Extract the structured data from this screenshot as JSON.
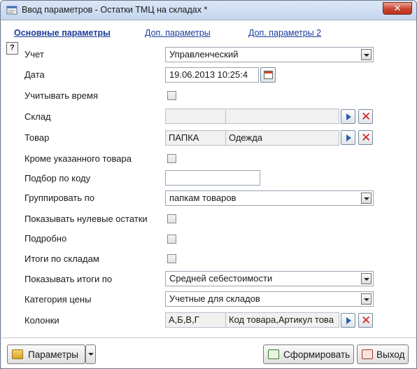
{
  "window": {
    "title": "Ввод параметров - Остатки ТМЦ на складах *",
    "close_label": "✕"
  },
  "tabs": [
    {
      "label": "Основные параметры",
      "active": true
    },
    {
      "label": "Доп. параметры",
      "active": false
    },
    {
      "label": "Доп. параметры 2",
      "active": false
    }
  ],
  "help_label": "?",
  "form": {
    "uchet": {
      "label": "Учет",
      "value": "Управленческий"
    },
    "data": {
      "label": "Дата",
      "value": "19.06.2013 10:25:4"
    },
    "uchityvat_vremya": {
      "label": "Учитывать время",
      "checked": false
    },
    "sklad": {
      "label": "Склад",
      "code": "",
      "name": ""
    },
    "tovar": {
      "label": "Товар",
      "code": "ПАПКА",
      "name": "Одежда"
    },
    "krome_tovara": {
      "label": "Кроме указанного товара",
      "checked": false
    },
    "podbor_po_kodu": {
      "label": "Подбор по коду",
      "value": ""
    },
    "gruppirovat_po": {
      "label": "Группировать по",
      "value": "папкам товаров"
    },
    "pokazyvat_nulevye": {
      "label": "Показывать нулевые остатки",
      "checked": false
    },
    "podrobno": {
      "label": "Подробно",
      "checked": false
    },
    "itogi_po_skladam": {
      "label": "Итоги по складам",
      "checked": false
    },
    "pokazyvat_itogi_po": {
      "label": "Показывать итоги по",
      "value": "Средней себестоимости"
    },
    "kategoriya_ceny": {
      "label": "Категория цены",
      "value": "Учетные для складов"
    },
    "kolonki": {
      "label": "Колонки",
      "code": "А,Б,В,Г",
      "name": "Код товара,Артикул това"
    }
  },
  "footer": {
    "params_label": "Параметры",
    "generate_label": "Сформировать",
    "exit_label": "Выход"
  }
}
